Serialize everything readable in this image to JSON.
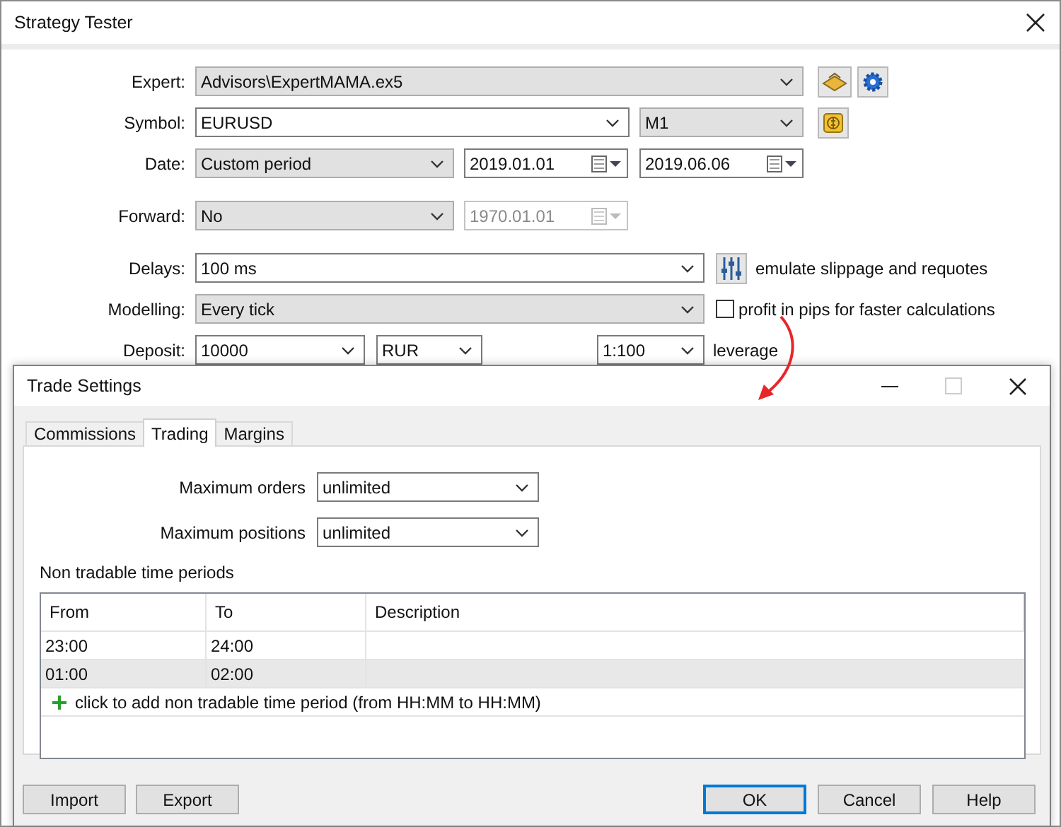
{
  "window": {
    "title": "Strategy Tester"
  },
  "form": [
    {
      "label": "Expert:",
      "controls": [
        {
          "kind": "list",
          "value": "Advisors\\ExpertMAMA.ex5"
        },
        {
          "kind": "icon"
        },
        {
          "kind": "icon"
        }
      ]
    },
    {
      "label": "Symbol:",
      "controls": [
        {
          "kind": "edit",
          "value": "EURUSD"
        },
        {
          "kind": "list",
          "value": "M1"
        },
        {
          "kind": "icon"
        }
      ]
    },
    {
      "label": "Date:",
      "controls": [
        {
          "kind": "list",
          "value": "Custom period"
        },
        {
          "kind": "date",
          "value": "2019.01.01",
          "disabled": false
        },
        {
          "kind": "date",
          "value": "2019.06.06",
          "disabled": false
        }
      ]
    },
    {
      "label": "Forward:",
      "controls": [
        {
          "kind": "list",
          "value": "No"
        },
        {
          "kind": "date",
          "value": "1970.01.01",
          "disabled": true
        }
      ]
    },
    {
      "label": "Delays:",
      "controls": [
        {
          "kind": "edit",
          "value": "100 ms"
        },
        {
          "kind": "icon"
        },
        {
          "kind": "text",
          "text": "emulate slippage and requotes"
        }
      ]
    },
    {
      "label": "Modelling:",
      "controls": [
        {
          "kind": "list",
          "value": "Every tick"
        },
        {
          "kind": "checkbox",
          "label": "profit in pips for faster calculations",
          "checked": false
        }
      ]
    },
    {
      "label": "Deposit:",
      "controls": [
        {
          "kind": "edit",
          "value": "10000"
        },
        {
          "kind": "edit",
          "value": "RUR"
        },
        {
          "kind": "edit",
          "value": "1:100"
        },
        {
          "kind": "text",
          "text": "leverage"
        }
      ]
    }
  ],
  "dialog": {
    "title": "Trade Settings",
    "tabs": [
      {
        "label": "Commissions",
        "selected": false
      },
      {
        "label": "Trading",
        "selected": true
      },
      {
        "label": "Margins",
        "selected": false
      }
    ],
    "fields": [
      {
        "label": "Maximum orders",
        "value": "unlimited"
      },
      {
        "label": "Maximum positions",
        "value": "unlimited"
      }
    ],
    "section": "Non tradable time periods",
    "table": {
      "columns": [
        "From",
        "To",
        "Description"
      ],
      "rows": [
        {
          "cells": [
            "23:00",
            "24:00",
            ""
          ],
          "selected": false
        },
        {
          "cells": [
            "01:00",
            "02:00",
            ""
          ],
          "selected": true
        }
      ],
      "add_row": "click to add non tradable time period (from HH:MM to HH:MM)"
    },
    "buttons_left": [
      {
        "label": "Import",
        "default": false
      },
      {
        "label": "Export",
        "default": false
      }
    ],
    "buttons_right": [
      {
        "label": "OK",
        "default": true
      },
      {
        "label": "Cancel",
        "default": false
      },
      {
        "label": "Help",
        "default": false
      }
    ]
  }
}
